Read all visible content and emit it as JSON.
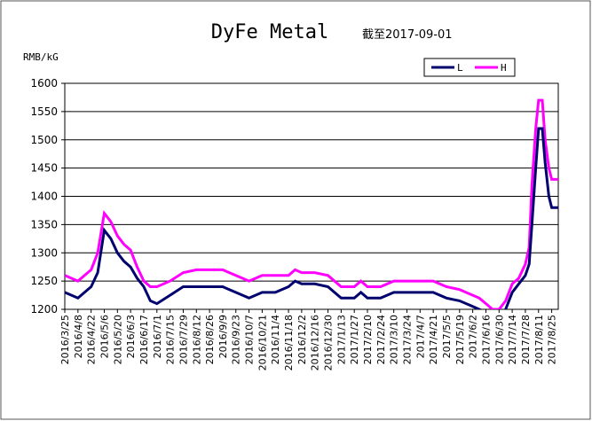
{
  "chart_data": {
    "type": "line",
    "title": "DyFe Metal",
    "subtitle": "截至2017-09-01",
    "ylabel": "RMB/kG",
    "ylim": [
      1200,
      1600
    ],
    "yticks": [
      1200,
      1250,
      1300,
      1350,
      1400,
      1450,
      1500,
      1550,
      1600
    ],
    "grid": true,
    "legend_position": "top-right",
    "colors": {
      "L": "#00006e",
      "H": "#ff00ff"
    },
    "categories": [
      "2016/3/25",
      "2016/4/8",
      "2016/4/22",
      "2016/5/6",
      "2016/5/20",
      "2016/6/3",
      "2016/6/17",
      "2016/7/1",
      "2016/7/15",
      "2016/7/29",
      "2016/8/12",
      "2016/8/26",
      "2016/9/9",
      "2016/9/23",
      "2016/10/7",
      "2016/10/21",
      "2016/11/4",
      "2016/11/18",
      "2016/12/2",
      "2016/12/16",
      "2016/12/30",
      "2017/1/13",
      "2017/1/27",
      "2017/2/10",
      "2017/2/24",
      "2017/3/10",
      "2017/3/24",
      "2017/4/7",
      "2017/4/21",
      "2017/5/5",
      "2017/5/19",
      "2017/6/2",
      "2017/6/16",
      "2017/6/30",
      "2017/7/14",
      "2017/7/28",
      "2017/8/11",
      "2017/8/25"
    ],
    "x": [
      "2016/3/25",
      "2016/4/8",
      "2016/4/22",
      "2016/4/29",
      "2016/5/6",
      "2016/5/13",
      "2016/5/20",
      "2016/5/27",
      "2016/6/3",
      "2016/6/10",
      "2016/6/17",
      "2016/6/24",
      "2016/7/1",
      "2016/7/15",
      "2016/7/29",
      "2016/8/12",
      "2016/8/26",
      "2016/9/9",
      "2016/9/23",
      "2016/10/7",
      "2016/10/21",
      "2016/11/4",
      "2016/11/18",
      "2016/11/25",
      "2016/12/2",
      "2016/12/16",
      "2016/12/30",
      "2017/1/13",
      "2017/1/27",
      "2017/2/3",
      "2017/2/10",
      "2017/2/24",
      "2017/3/10",
      "2017/3/24",
      "2017/4/7",
      "2017/4/21",
      "2017/5/5",
      "2017/5/19",
      "2017/6/2",
      "2017/6/9",
      "2017/6/16",
      "2017/6/23",
      "2017/6/30",
      "2017/7/7",
      "2017/7/14",
      "2017/7/21",
      "2017/7/28",
      "2017/8/1",
      "2017/8/4",
      "2017/8/8",
      "2017/8/11",
      "2017/8/15",
      "2017/8/18",
      "2017/8/22",
      "2017/8/25",
      "2017/9/1"
    ],
    "series": [
      {
        "name": "L",
        "values": [
          1230,
          1220,
          1240,
          1265,
          1340,
          1325,
          1300,
          1285,
          1275,
          1255,
          1240,
          1215,
          1210,
          1225,
          1240,
          1240,
          1240,
          1240,
          1230,
          1220,
          1230,
          1230,
          1240,
          1250,
          1245,
          1245,
          1240,
          1220,
          1220,
          1230,
          1220,
          1220,
          1230,
          1230,
          1230,
          1230,
          1220,
          1215,
          1205,
          1200,
          1195,
          1190,
          1190,
          1200,
          1230,
          1245,
          1260,
          1280,
          1350,
          1450,
          1520,
          1520,
          1460,
          1400,
          1380,
          1380
        ]
      },
      {
        "name": "H",
        "values": [
          1260,
          1250,
          1270,
          1300,
          1370,
          1355,
          1330,
          1315,
          1305,
          1275,
          1250,
          1240,
          1240,
          1250,
          1265,
          1270,
          1270,
          1270,
          1260,
          1250,
          1260,
          1260,
          1260,
          1270,
          1265,
          1265,
          1260,
          1240,
          1240,
          1250,
          1240,
          1240,
          1250,
          1250,
          1250,
          1250,
          1240,
          1235,
          1225,
          1220,
          1210,
          1200,
          1200,
          1215,
          1245,
          1255,
          1280,
          1310,
          1420,
          1520,
          1570,
          1570,
          1500,
          1450,
          1430,
          1430
        ]
      }
    ]
  }
}
